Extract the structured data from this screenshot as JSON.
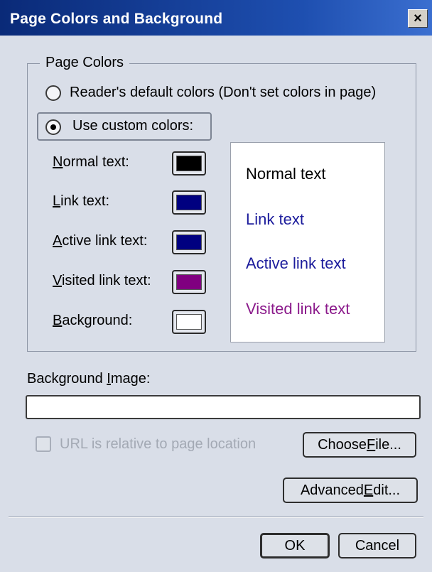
{
  "window": {
    "title": "Page Colors and Background",
    "close_glyph": "×"
  },
  "page_colors": {
    "group_label": "Page Colors",
    "option_default": {
      "label": "Reader's default colors (Don't set colors in page)",
      "selected": false
    },
    "option_custom": {
      "label": "Use custom colors:",
      "selected": true
    },
    "rows": [
      {
        "accel": "N",
        "rest": "ormal text:",
        "color": "#000000"
      },
      {
        "accel": "L",
        "rest": "ink text:",
        "color": "#000080"
      },
      {
        "accel": "A",
        "rest": "ctive link text:",
        "color": "#000080"
      },
      {
        "accel": "V",
        "rest": "isited link text:",
        "color": "#800080"
      },
      {
        "accel": "B",
        "rest": "ackground:",
        "color": "#ffffff"
      }
    ],
    "preview": {
      "normal": "Normal text",
      "link": "Link text",
      "active": "Active link text",
      "visited": "Visited link text",
      "normal_color": "#000000",
      "link_color": "#1c1c9c",
      "active_color": "#1c1c9c",
      "visited_color": "#8b1a8b"
    }
  },
  "background_image": {
    "label_pre": "Background ",
    "label_accel": "I",
    "label_post": "mage:",
    "value": "",
    "relative_checkbox": {
      "label": "URL is relative to page location",
      "checked": false,
      "enabled": false
    },
    "choose_file": {
      "pre": "Choose ",
      "accel": "F",
      "post": "ile..."
    },
    "advanced_edit": {
      "pre": "Advanced ",
      "accel": "E",
      "post": "dit..."
    }
  },
  "footer": {
    "ok_label": "OK",
    "cancel_label": "Cancel"
  }
}
